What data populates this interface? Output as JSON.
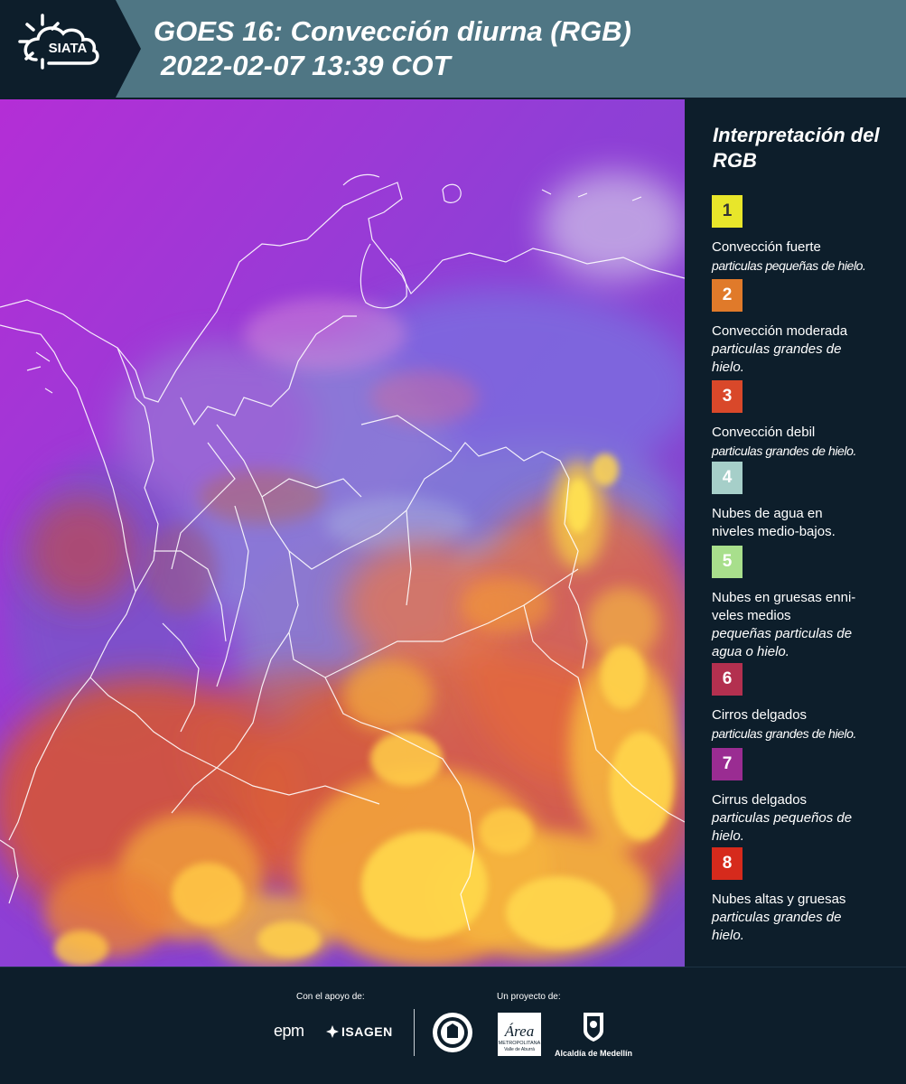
{
  "header": {
    "logo_text": "SIATA",
    "title_line1": "GOES 16: Convección diurna (RGB)",
    "title_line2": "2022-02-07 13:39 COT"
  },
  "legend": {
    "title": "Interpretación del RGB",
    "items": [
      {
        "number": "1",
        "color": "#e8e62a",
        "text_color": "#333333",
        "name": "Convección fuerte",
        "desc": "particulas pequeñas de hielo."
      },
      {
        "number": "2",
        "color": "#e07a2a",
        "text_color": "#ffffff",
        "name": "Convección moderada",
        "desc": "particulas grandes de hielo."
      },
      {
        "number": "3",
        "color": "#d9482a",
        "text_color": "#ffffff",
        "name": "Convección debil",
        "desc": "particulas grandes de hielo."
      },
      {
        "number": "4",
        "color": "#a6cfc9",
        "text_color": "#ffffff",
        "name": "Nubes de agua en niveles medio-bajos.",
        "desc": ""
      },
      {
        "number": "5",
        "color": "#a8df8c",
        "text_color": "#ffffff",
        "name": "Nubes en gruesas enni-veles medios",
        "desc": "pequeñas particulas de agua o hielo."
      },
      {
        "number": "6",
        "color": "#b3304f",
        "text_color": "#ffffff",
        "name": "Cirros delgados",
        "desc": "particulas grandes de hielo."
      },
      {
        "number": "7",
        "color": "#9a2c92",
        "text_color": "#ffffff",
        "name": "Cirrus delgados",
        "desc": "particulas pequeños de hielo."
      },
      {
        "number": "8",
        "color": "#d62a1c",
        "text_color": "#ffffff",
        "name": "Nubes altas y gruesas",
        "desc": "particulas grandes de hielo."
      }
    ]
  },
  "footer": {
    "support_label": "Con el apoyo de:",
    "project_label": "Un proyecto de:",
    "sponsor1": "epm",
    "sponsor2": "ISAGEN",
    "partner_area": "Área",
    "partner_area_sub1": "METROPOLITANA",
    "partner_area_sub2": "Valle de Aburrá",
    "partner_alcaldia": "Alcaldía de Medellín"
  }
}
